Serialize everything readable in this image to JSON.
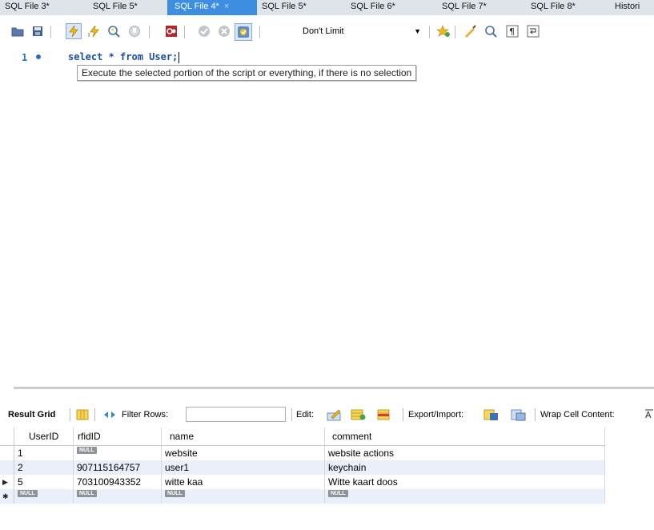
{
  "tabs": [
    {
      "label": "SQL File 3*",
      "active": false
    },
    {
      "label": "SQL File 5*",
      "active": false
    },
    {
      "label": "SQL File 4*",
      "active": true
    },
    {
      "label": "SQL File 5*",
      "active": false
    },
    {
      "label": "SQL File 6*",
      "active": false
    },
    {
      "label": "SQL File 7*",
      "active": false
    },
    {
      "label": "SQL File 8*",
      "active": false
    },
    {
      "label": "Histori",
      "active": false
    }
  ],
  "tab_close_glyph": "×",
  "toolbar": {
    "limit_label": "Don't Limit",
    "icons": [
      "open-folder-icon",
      "save-icon",
      "execute-lightning-icon",
      "execute-cursor-icon",
      "explain-icon",
      "stop-icon",
      "toggle-error-icon",
      "commit-icon",
      "rollback-icon",
      "autocommit-icon",
      "bookmark-star-icon",
      "beautify-icon",
      "find-icon",
      "invisible-chars-icon",
      "wrap-icon"
    ]
  },
  "editor": {
    "line_number": "1",
    "code": "select * from User;",
    "tooltip": "Execute the selected portion of the script or everything, if there is no selection"
  },
  "result_toolbar": {
    "result_grid_label": "Result Grid",
    "filter_rows_label": "Filter Rows:",
    "edit_label": "Edit:",
    "export_import_label": "Export/Import:",
    "wrap_label": "Wrap Cell Content:"
  },
  "grid": {
    "columns": [
      "UserID",
      "rfidID",
      "name",
      "comment"
    ],
    "rows": [
      {
        "indicator": "",
        "UserID": "1",
        "rfidID": "NULL",
        "name": "website",
        "comment": "website actions"
      },
      {
        "indicator": "",
        "UserID": "2",
        "rfidID": "907115164757",
        "name": "user1",
        "comment": "keychain"
      },
      {
        "indicator": "▶",
        "UserID": "5",
        "rfidID": "703100943352",
        "name": "witte kaa",
        "comment": "Witte kaart doos"
      },
      {
        "indicator": "✱",
        "UserID": "NULL",
        "rfidID": "NULL",
        "name": "NULL",
        "comment": "NULL"
      }
    ],
    "null_label": "NULL"
  },
  "colors": {
    "accent": "#3d8ee0",
    "code": "#1a4fa8",
    "row_alt": "#e9f0fa"
  }
}
